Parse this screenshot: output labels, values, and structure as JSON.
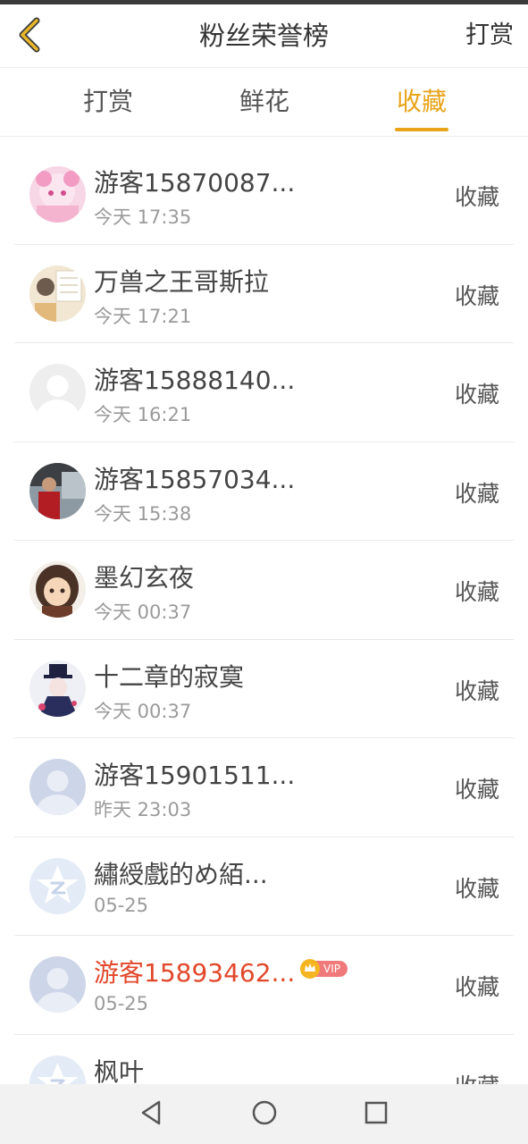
{
  "header": {
    "title": "粉丝荣誉榜",
    "action": "打赏"
  },
  "tabs": [
    {
      "label": "打赏",
      "active": false
    },
    {
      "label": "鲜花",
      "active": false
    },
    {
      "label": "收藏",
      "active": true
    }
  ],
  "accent_color": "#e8a317",
  "vip_name_color": "#e2472a",
  "fans": [
    {
      "name": "游客15870087...",
      "time": "今天 17:35",
      "action": "收藏",
      "avatar": "anime-pink-avatar",
      "vip": false
    },
    {
      "name": "万兽之王哥斯拉",
      "time": "今天 17:21",
      "action": "收藏",
      "avatar": "photo-avatar",
      "vip": false
    },
    {
      "name": "游客15888140...",
      "time": "今天 16:21",
      "action": "收藏",
      "avatar": "default-gray-avatar",
      "vip": false
    },
    {
      "name": "游客15857034...",
      "time": "今天 15:38",
      "action": "收藏",
      "avatar": "photo-person-avatar",
      "vip": false
    },
    {
      "name": "墨幻玄夜",
      "time": "今天 00:37",
      "action": "收藏",
      "avatar": "anime-girl-avatar",
      "vip": false
    },
    {
      "name": "十二章的寂寞",
      "time": "今天 00:37",
      "action": "收藏",
      "avatar": "anime-hat-avatar",
      "vip": false
    },
    {
      "name": "游客15901511...",
      "time": "昨天 23:03",
      "action": "收藏",
      "avatar": "default-blue-avatar",
      "vip": false
    },
    {
      "name": "繡綬戲的め絔...",
      "time": "05-25",
      "action": "收藏",
      "avatar": "qzone-star-avatar",
      "vip": false
    },
    {
      "name": "游客15893462...",
      "time": "05-25",
      "action": "收藏",
      "avatar": "default-blue-avatar",
      "vip": true,
      "vip_label": "VIP"
    },
    {
      "name": "枫叶",
      "time": "",
      "action": "收藏",
      "avatar": "qzone-star-avatar",
      "vip": false
    }
  ]
}
